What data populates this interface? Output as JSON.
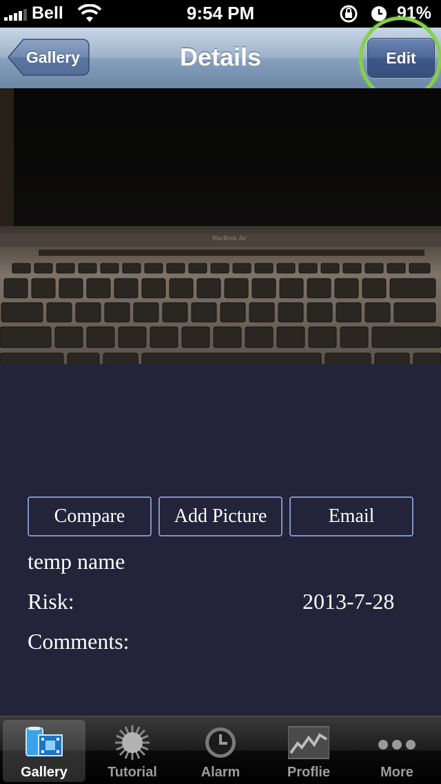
{
  "status_bar": {
    "carrier": "Bell",
    "time": "9:54 PM",
    "battery": "91%"
  },
  "nav_bar": {
    "title": "Details",
    "back_label": "Gallery",
    "edit_label": "Edit"
  },
  "photo": {
    "brand_text": "MacBook Air"
  },
  "actions": {
    "compare_label": "Compare",
    "add_picture_label": "Add Picture",
    "email_label": "Email"
  },
  "details": {
    "name": "temp name",
    "risk_label": "Risk:",
    "date": "2013-7-28",
    "comments_label": "Comments:"
  },
  "tab_bar": {
    "tabs": [
      {
        "label": "Gallery",
        "icon": "gallery-icon",
        "selected": true
      },
      {
        "label": "Tutorial",
        "icon": "sun-icon",
        "selected": false
      },
      {
        "label": "Alarm",
        "icon": "clock-icon",
        "selected": false
      },
      {
        "label": "Proflie",
        "icon": "chart-icon",
        "selected": false
      },
      {
        "label": "More",
        "icon": "more-icon",
        "selected": false
      }
    ]
  },
  "colors": {
    "background": "#23233a",
    "button_border": "#7f95c6",
    "highlight_ring": "#86d04a"
  }
}
